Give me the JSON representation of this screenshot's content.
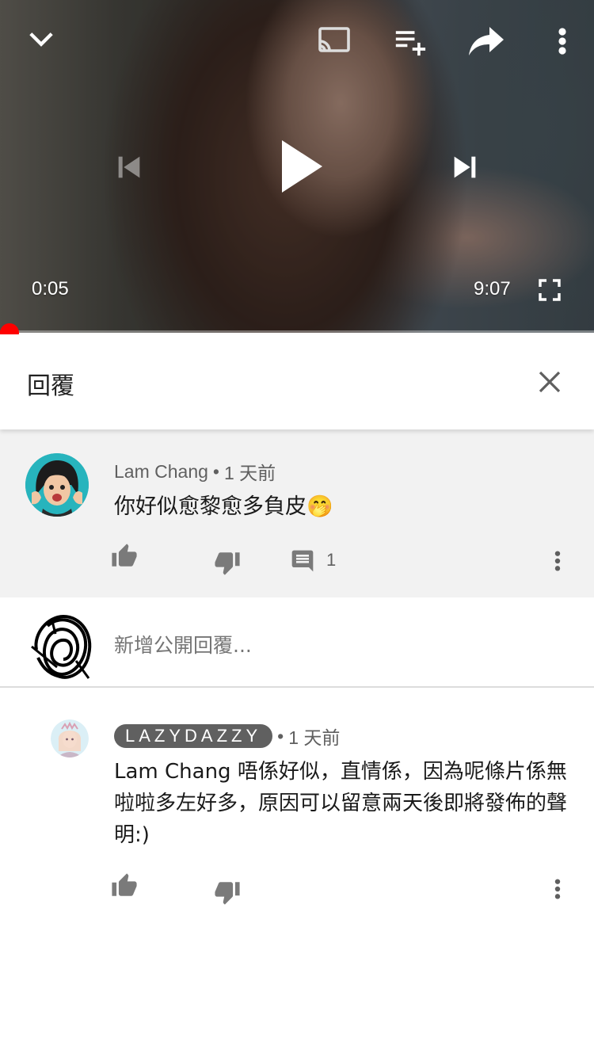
{
  "player": {
    "current_time": "0:05",
    "duration": "9:07",
    "progress_fraction": 0.009,
    "accent_color": "#ff0000",
    "icons": {
      "minimize": "chevron-down-icon",
      "cast": "cast-icon",
      "add_to_playlist": "playlist-add-icon",
      "share": "share-icon",
      "more": "more-vert-icon",
      "previous": "skip-previous-icon",
      "play": "play-icon",
      "next": "skip-next-icon",
      "fullscreen": "fullscreen-icon"
    }
  },
  "replies_panel": {
    "title": "回覆",
    "close_icon": "close-icon"
  },
  "parent_comment": {
    "author": "Lam Chang",
    "separator": "•",
    "time": "1 天前",
    "text": "你好似愈黎愈多負皮",
    "emoji": "🤭",
    "reply_count": "1",
    "icons": [
      "thumb-up-icon",
      "thumb-down-icon",
      "reply-icon",
      "more-vert-icon"
    ]
  },
  "add_reply": {
    "placeholder": "新增公開回覆..."
  },
  "reply": {
    "author": "LAZYDAZZY",
    "separator": "•",
    "time": "1 天前",
    "text": "Lam Chang 唔係好似，直情係，因為呢條片係無啦啦多左好多，原因可以留意兩天後即將發佈的聲明:)",
    "icons": [
      "thumb-up-icon",
      "thumb-down-icon",
      "more-vert-icon"
    ]
  }
}
